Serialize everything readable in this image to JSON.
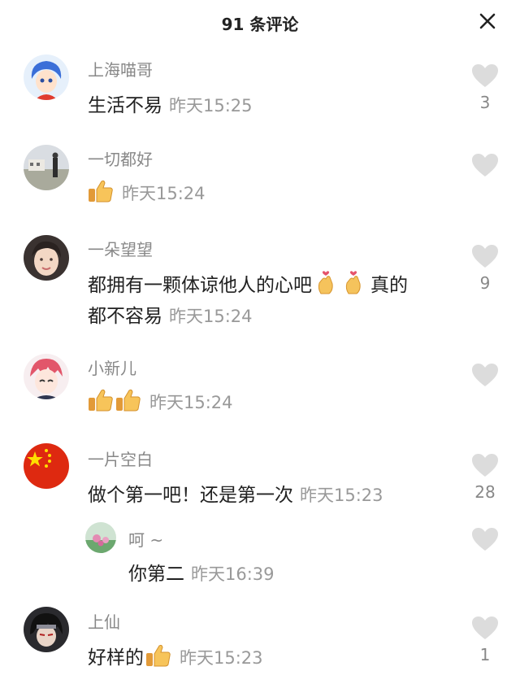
{
  "header": {
    "title": "91 条评论"
  },
  "comments": [
    {
      "author": "上海喵哥",
      "text": "生活不易",
      "time": "昨天15:25",
      "likes": "3"
    },
    {
      "author": "一切都好",
      "text": "",
      "time": "昨天15:24",
      "likes": ""
    },
    {
      "author": "一朵望望",
      "text_line1": "都拥有一颗体谅他人的心吧",
      "text_line1_tail": "真的",
      "text_line2": "都不容易",
      "time": "昨天15:24",
      "likes": "9"
    },
    {
      "author": "小新儿",
      "text": "",
      "time": "昨天15:24",
      "likes": ""
    },
    {
      "author": "一片空白",
      "text": "做个第一吧！还是第一次",
      "time": "昨天15:23",
      "likes": "28"
    },
    {
      "author": "呵 ~",
      "text": "你第二",
      "time": "昨天16:39",
      "likes": ""
    },
    {
      "author": "上仙",
      "text": "好样的",
      "time": "昨天15:23",
      "likes": "1"
    }
  ],
  "icons": {
    "close": "close-icon",
    "like": "heart-icon",
    "thumbs_up": "thumbs-up-emoji",
    "finger_heart": "finger-heart-emoji"
  },
  "colors": {
    "heart": "#dcdcdc",
    "name": "#888888",
    "time": "#999999"
  }
}
